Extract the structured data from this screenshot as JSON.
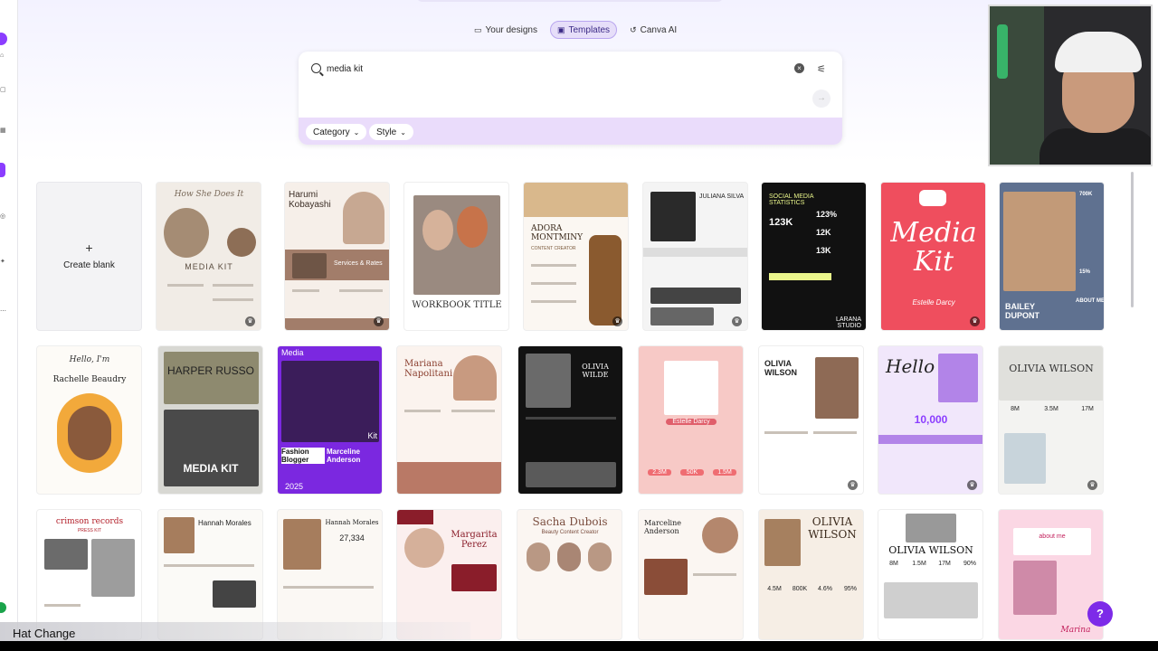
{
  "nav_tabs": [
    {
      "icon": "designs-icon",
      "label": "Your designs",
      "active": false
    },
    {
      "icon": "templates-icon",
      "label": "Templates",
      "active": true
    },
    {
      "icon": "canva-ai-icon",
      "label": "Canva AI",
      "active": false
    }
  ],
  "search": {
    "value": "media kit",
    "placeholder": ""
  },
  "filters": {
    "category": "Category",
    "style": "Style"
  },
  "create_blank": {
    "plus": "+",
    "label": "Create blank"
  },
  "cards": {
    "c1": {
      "title": "How She Does It",
      "sub": "MEDIA KIT"
    },
    "c2": {
      "title": "Harumi Kobayashi",
      "sub": "Services & Rates"
    },
    "c3": {
      "title": "WORKBOOK TITLE"
    },
    "c4": {
      "title": "ADORA MONTMINY",
      "sub": "CONTENT CREATOR"
    },
    "c5": {
      "title": "JULIANA SILVA"
    },
    "c6": {
      "title": "SOCIAL MEDIA STATISTICS",
      "a": "123K",
      "b": "123%",
      "c": "12K",
      "d": "13K",
      "foot": "LARANA STUDIO"
    },
    "c7": {
      "title": "Media Kit",
      "sub": "Estelle Darcy"
    },
    "c8": {
      "title": "BAILEY DUPONT",
      "a": "700K",
      "b": "15%",
      "c": "ABOUT ME"
    },
    "c9": {
      "title": "Hello, I'm",
      "sub": "Rachelle Beaudry"
    },
    "c10": {
      "title": "HARPER RUSSO",
      "sub": "MEDIA KIT"
    },
    "c11": {
      "title": "Media",
      "a": "Kit",
      "b": "Fashion Blogger",
      "c": "Marceline Anderson",
      "d": "2025"
    },
    "c12": {
      "title": "Mariana Napolitani"
    },
    "c13": {
      "title": "OLIVIA WILDE"
    },
    "c14": {
      "title": "Estelle Darcy",
      "a": "2.3M",
      "b": "50K",
      "c": "1.5M"
    },
    "c15": {
      "title": "OLIVIA WILSON"
    },
    "c16": {
      "title": "Hello",
      "sub": "10,000"
    },
    "c17": {
      "title": "OLIVIA WILSON",
      "a": "8M",
      "b": "3.5M",
      "c": "17M"
    },
    "c18": {
      "title": "crimson records",
      "sub": "PRESS KIT"
    },
    "c19": {
      "title": "Hannah Morales"
    },
    "c20": {
      "title": "Hannah Morales",
      "sub": "27,334"
    },
    "c21": {
      "title": "Margarita Perez"
    },
    "c22": {
      "title": "Sacha Dubois",
      "sub": "Beauty Content Creator"
    },
    "c23": {
      "title": "Marceline Anderson"
    },
    "c24": {
      "title": "OLIVIA WILSON",
      "a": "4.5M",
      "b": "800K",
      "c": "4.6%",
      "d": "95%"
    },
    "c25": {
      "title": "OLIVIA WILSON",
      "a": "8M",
      "b": "1.5M",
      "c": "17M",
      "d": "90%"
    },
    "c26": {
      "title": "about me",
      "sub": "Marina"
    }
  },
  "help": "?",
  "caption": "Hat Change",
  "colors": {
    "accent": "#8b3dff",
    "help": "#7d2ae8",
    "chip_bar": "#eadcfb"
  }
}
